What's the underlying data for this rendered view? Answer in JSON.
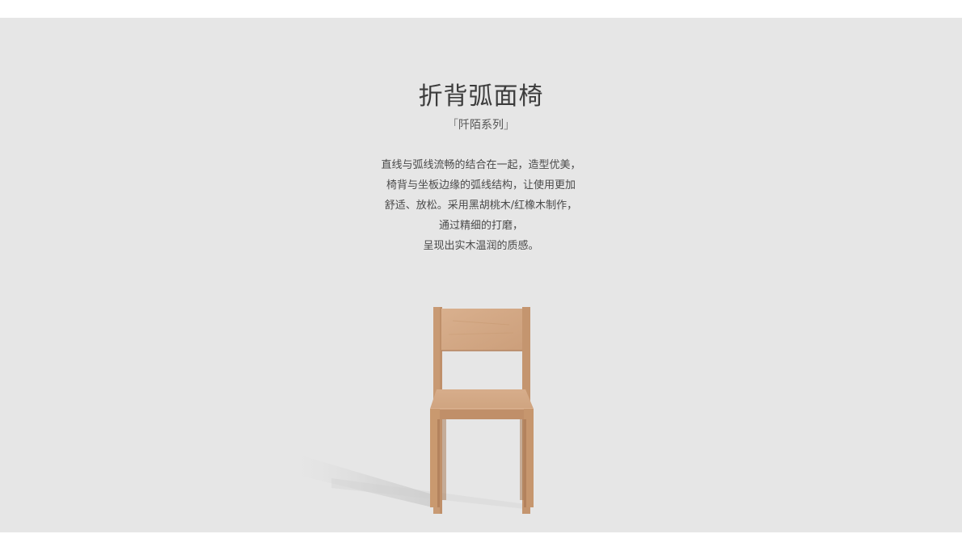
{
  "product": {
    "title": "折背弧面椅",
    "series_open": "「",
    "series_name": "阡陌系列",
    "series_close": "」",
    "description_lines": [
      "直线与弧线流畅的结合在一起，造型优美，",
      "椅背与坐板边缘的弧线结构，让使用更加",
      "舒适、放松。采用黑胡桃木/红橡木制作，",
      "通过精细的打磨，",
      "呈现出实木温润的质感。"
    ],
    "image": "wooden-chair-photo"
  },
  "colors": {
    "background": "#e6e6e6",
    "wood_light": "#d2a684",
    "wood_dark": "#b98863",
    "text_dark": "#3c3c3c"
  }
}
